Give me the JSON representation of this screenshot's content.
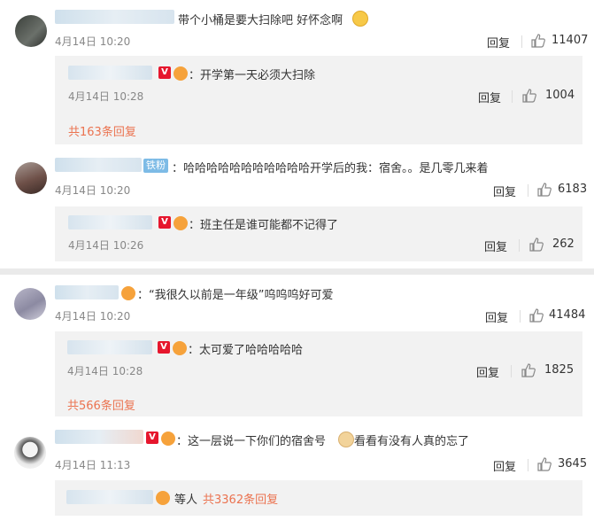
{
  "colors": {
    "accent": "#eb7350",
    "v_badge": "#e6162d",
    "tag": "#7dbbe6"
  },
  "comments": [
    {
      "text": "带个小桶是要大扫除吧 好怀念啊",
      "emoji": "smile-sad-emoji",
      "time": "4月14日 10:20",
      "reply_label": "回复",
      "likes": "11407",
      "sub": {
        "text": "：开学第一天必须大扫除",
        "time": "4月14日 10:28",
        "reply_label": "回复",
        "likes": "1004"
      },
      "more": "共163条回复"
    },
    {
      "tag": "铁粉",
      "text": "：哈哈哈哈哈哈哈哈哈哈哈开学后的我：宿舍。。是几零几来着",
      "time": "4月14日 10:20",
      "reply_label": "回复",
      "likes": "6183",
      "sub": {
        "text": "：班主任是谁可能都不记得了",
        "time": "4月14日 10:26",
        "reply_label": "回复",
        "likes": "262"
      }
    },
    {
      "text": "：“我很久以前是一年级”呜呜呜好可爱",
      "time": "4月14日 10:20",
      "reply_label": "回复",
      "likes": "41484",
      "sub": {
        "text": "：太可爱了哈哈哈哈哈",
        "time": "4月14日 10:28",
        "reply_label": "回复",
        "likes": "1825"
      },
      "more": "共566条回复"
    },
    {
      "text": "：这一层说一下你们的宿舍号",
      "text2": "看看有没有人真的忘了",
      "time": "4月14日 11:13",
      "reply_label": "回复",
      "likes": "3645",
      "sub": {
        "text": "等人",
        "more": "共3362条回复"
      }
    }
  ]
}
